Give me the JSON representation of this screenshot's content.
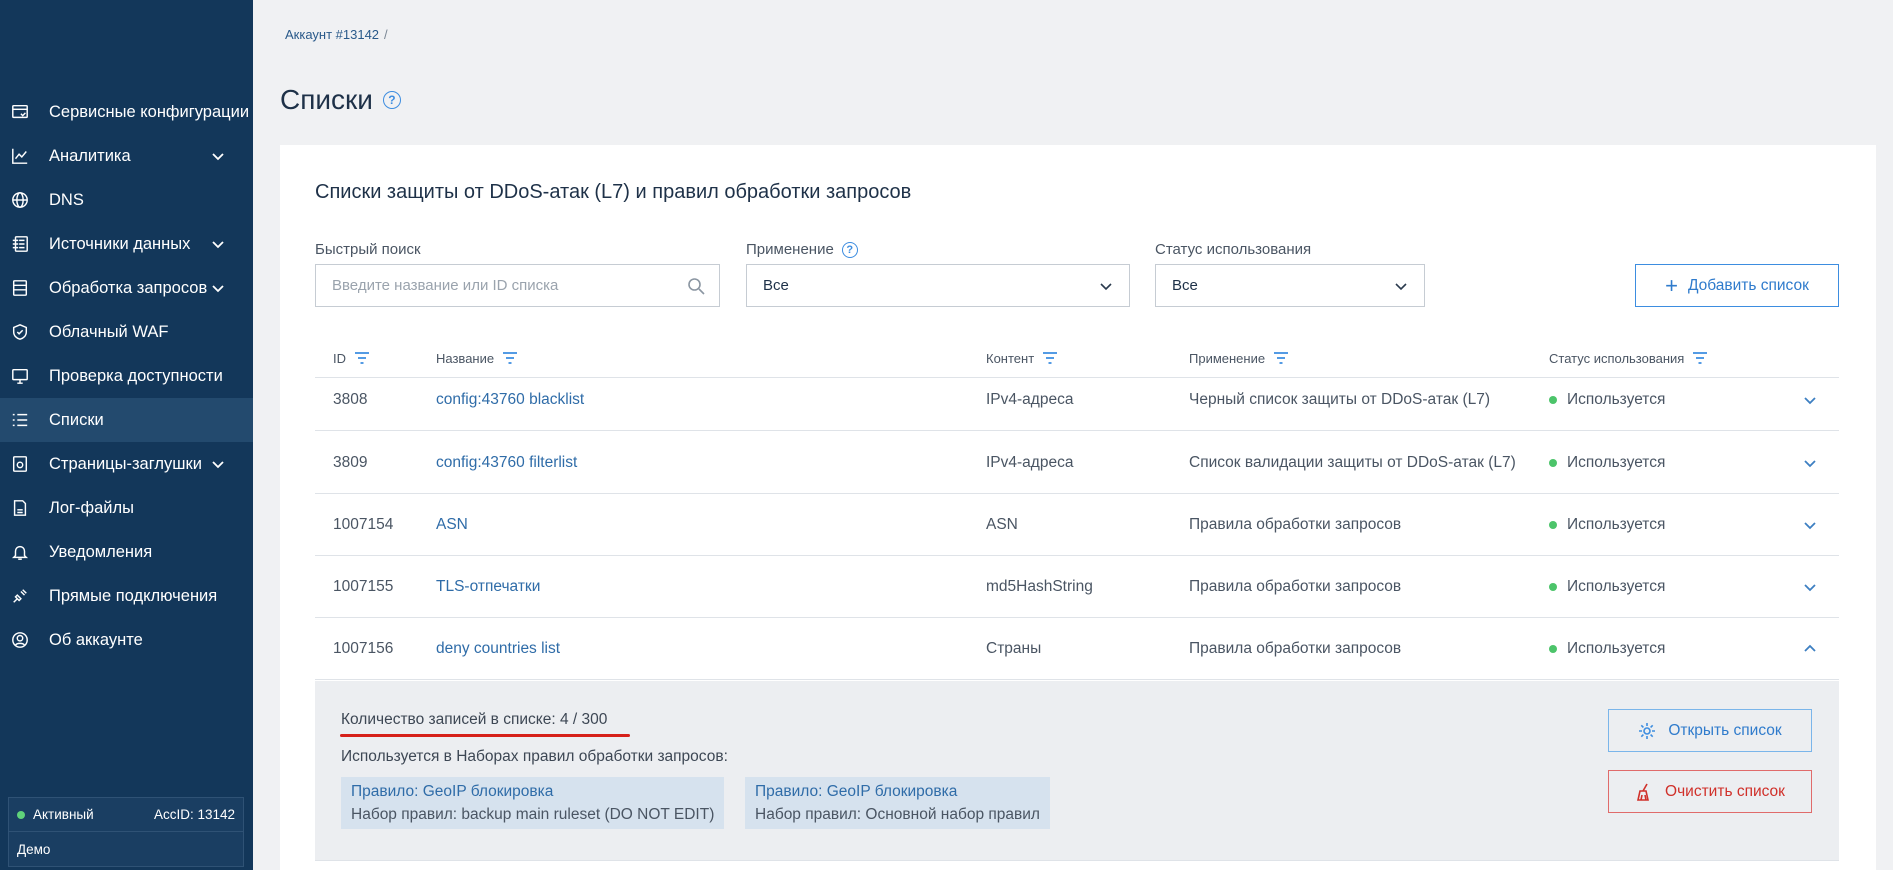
{
  "breadcrumb": {
    "account": "Аккаунт #13142",
    "separator": "/"
  },
  "page": {
    "title": "Списки",
    "help_icon": "?"
  },
  "sidebar": {
    "items": [
      {
        "label": "Сервисные конфигурации",
        "icon": "config-icon",
        "has_chevron": false
      },
      {
        "label": "Аналитика",
        "icon": "chart-line-icon",
        "has_chevron": true
      },
      {
        "label": "DNS",
        "icon": "globe-icon",
        "has_chevron": false
      },
      {
        "label": "Источники данных",
        "icon": "data-source-icon",
        "has_chevron": true
      },
      {
        "label": "Обработка запросов",
        "icon": "server-icon",
        "has_chevron": true
      },
      {
        "label": "Облачный WAF",
        "icon": "shield-icon",
        "has_chevron": false
      },
      {
        "label": "Проверка доступности",
        "icon": "monitor-icon",
        "has_chevron": false
      },
      {
        "label": "Списки",
        "icon": "list-icon",
        "has_chevron": false,
        "active": true
      },
      {
        "label": "Страницы-заглушки",
        "icon": "page-icon",
        "has_chevron": true
      },
      {
        "label": "Лог-файлы",
        "icon": "log-file-icon",
        "has_chevron": false
      },
      {
        "label": "Уведомления",
        "icon": "bell-icon",
        "has_chevron": false
      },
      {
        "label": "Прямые подключения",
        "icon": "plug-icon",
        "has_chevron": false
      },
      {
        "label": "Об аккаунте",
        "icon": "user-icon",
        "has_chevron": false
      }
    ],
    "status": {
      "state": "Активный",
      "acc_id": "AccID: 13142",
      "plan": "Демо",
      "state_color": "#5fd27a"
    }
  },
  "card": {
    "title": "Списки защиты от DDoS-атак (L7) и правил обработки запросов",
    "filters": {
      "search_label": "Быстрый поиск",
      "search_placeholder": "Введите название или ID списка",
      "apply_label": "Применение",
      "apply_value": "Все",
      "status_label": "Статус использования",
      "status_value": "Все"
    },
    "add_button": "Добавить список"
  },
  "table": {
    "columns": [
      "ID",
      "Название",
      "Контент",
      "Применение",
      "Статус использования"
    ],
    "rows": [
      {
        "id": "3808",
        "name": "config:43760 blacklist",
        "content": "IPv4-адреса",
        "apply": "Черный список защиты от DDoS-атак (L7)",
        "status": "Используется",
        "expanded": false
      },
      {
        "id": "3809",
        "name": "config:43760 filterlist",
        "content": "IPv4-адреса",
        "apply": "Список валидации защиты от DDoS-атак (L7)",
        "status": "Используется",
        "expanded": false
      },
      {
        "id": "1007154",
        "name": "ASN",
        "content": "ASN",
        "apply": "Правила обработки запросов",
        "status": "Используется",
        "expanded": false
      },
      {
        "id": "1007155",
        "name": "TLS-отпечатки",
        "content": "md5HashString",
        "apply": "Правила обработки запросов",
        "status": "Используется",
        "expanded": false
      },
      {
        "id": "1007156",
        "name": "deny countries list",
        "content": "Страны",
        "apply": "Правила обработки запросов",
        "status": "Используется",
        "expanded": true
      }
    ]
  },
  "expanded": {
    "count_text": "Количество записей в списке: 4 / 300",
    "used_text": "Используется в Наборах правил обработки запросов:",
    "rules": [
      {
        "rule": "Правило: GeoIP блокировка",
        "ruleset": "Набор правил: backup main ruleset (DO NOT EDIT)"
      },
      {
        "rule": "Правило: GeoIP блокировка",
        "ruleset": "Набор правил: Основной набор правил"
      }
    ],
    "open_button": "Открыть список",
    "clear_button": "Очистить список"
  },
  "colors": {
    "sidebar_bg": "#13375a",
    "accent": "#3d8de0",
    "status_ok": "#4cc46a",
    "danger": "#d0302a"
  }
}
